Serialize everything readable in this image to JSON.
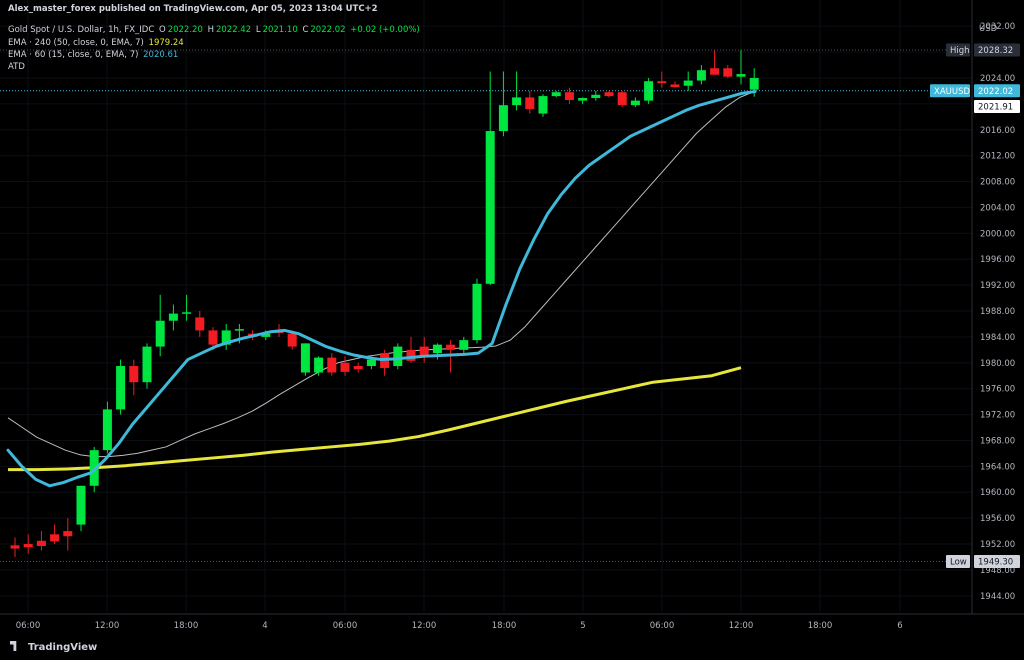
{
  "header": {
    "published": "Alex_master_forex published on TradingView.com, Apr 05, 2023 13:04 UTC+2",
    "symbol": "Gold Spot / U.S. Dollar, 1h, FX_IDC",
    "o_label": "O",
    "o": "2022.20",
    "h_label": "H",
    "h": "2022.42",
    "l_label": "L",
    "l": "2021.10",
    "c_label": "C",
    "c": "2022.02",
    "change": "+0.02 (+0.00%)",
    "ema240_label": "EMA · 240 (50, close, 0, EMA, 7)",
    "ema240_value": "1979.24",
    "ema60_label": "EMA · 60 (15, close, 0, EMA, 7)",
    "ema60_value": "2020.61",
    "atd_label": "ATD"
  },
  "footer": {
    "logo_text": "TradingView"
  },
  "colors": {
    "background": "#000000",
    "up": "#00e640",
    "down": "#f21c22",
    "ema_fast": "#3fb8da",
    "ema_slow": "#e7e63c",
    "ema_grey": "#bdbdbd",
    "axis_text": "#b2b5be",
    "price_tag": "#3fb8da"
  },
  "chart_data": {
    "type": "candlestick",
    "currency": "USD",
    "x_ticks": [
      "06:00",
      "12:00",
      "18:00",
      "4",
      "06:00",
      "12:00",
      "18:00",
      "5",
      "06:00",
      "12:00",
      "18:00",
      "6"
    ],
    "y_ticks": [
      "2032.00",
      "2028.00",
      "2024.00",
      "2020.00",
      "2016.00",
      "2012.00",
      "2008.00",
      "2004.00",
      "2000.00",
      "1996.00",
      "1992.00",
      "1988.00",
      "1984.00",
      "1980.00",
      "1976.00",
      "1972.00",
      "1968.00",
      "1964.00",
      "1960.00",
      "1956.00",
      "1952.00",
      "1948.00",
      "1944.00"
    ],
    "ylim": [
      1941.5,
      2034.5
    ],
    "high_label": "High",
    "high": "2028.32",
    "low_label": "Low",
    "low": "1949.30",
    "last_symbol": "XAUUSD",
    "last_price": "2022.02",
    "ema_tag": "2021.91",
    "candles": [
      {
        "o": 1951.8,
        "h": 1953,
        "l": 1950,
        "c": 1951.3
      },
      {
        "o": 1952.0,
        "h": 1953.5,
        "l": 1950.5,
        "c": 1951.5
      },
      {
        "o": 1952.5,
        "h": 1954,
        "l": 1951,
        "c": 1951.7
      },
      {
        "o": 1953.5,
        "h": 1955,
        "l": 1952,
        "c": 1952.4
      },
      {
        "o": 1954.0,
        "h": 1956,
        "l": 1951,
        "c": 1953.2
      },
      {
        "o": 1955.0,
        "h": 1961,
        "l": 1954,
        "c": 1961.0
      },
      {
        "o": 1961.0,
        "h": 1967,
        "l": 1960,
        "c": 1966.5
      },
      {
        "o": 1966.5,
        "h": 1974,
        "l": 1966,
        "c": 1972.8
      },
      {
        "o": 1972.8,
        "h": 1980.5,
        "l": 1972,
        "c": 1979.5
      },
      {
        "o": 1979.5,
        "h": 1980.5,
        "l": 1975,
        "c": 1977.0
      },
      {
        "o": 1977.0,
        "h": 1983,
        "l": 1976,
        "c": 1982.5
      },
      {
        "o": 1982.5,
        "h": 1990.5,
        "l": 1981,
        "c": 1986.5
      },
      {
        "o": 1986.5,
        "h": 1989,
        "l": 1985,
        "c": 1987.6
      },
      {
        "o": 1987.6,
        "h": 1990.5,
        "l": 1986.5,
        "c": 1987.8
      },
      {
        "o": 1987.0,
        "h": 1988,
        "l": 1984,
        "c": 1985.0
      },
      {
        "o": 1985.0,
        "h": 1985.5,
        "l": 1982,
        "c": 1982.8
      },
      {
        "o": 1982.8,
        "h": 1986,
        "l": 1982,
        "c": 1985.0
      },
      {
        "o": 1985.0,
        "h": 1986,
        "l": 1983,
        "c": 1985.2
      },
      {
        "o": 1984.5,
        "h": 1985,
        "l": 1983.5,
        "c": 1984.0
      },
      {
        "o": 1984.0,
        "h": 1985,
        "l": 1983.5,
        "c": 1984.5
      },
      {
        "o": 1985.0,
        "h": 1986,
        "l": 1984,
        "c": 1984.6
      },
      {
        "o": 1984.5,
        "h": 1985,
        "l": 1982,
        "c": 1982.5
      },
      {
        "o": 1978.5,
        "h": 1983,
        "l": 1978,
        "c": 1983.0
      },
      {
        "o": 1978.5,
        "h": 1981,
        "l": 1978,
        "c": 1980.8
      },
      {
        "o": 1980.8,
        "h": 1981.5,
        "l": 1978,
        "c": 1978.5
      },
      {
        "o": 1980.0,
        "h": 1981,
        "l": 1978,
        "c": 1978.6
      },
      {
        "o": 1979.5,
        "h": 1980,
        "l": 1978.5,
        "c": 1979.0
      },
      {
        "o": 1979.5,
        "h": 1981,
        "l": 1979,
        "c": 1980.5
      },
      {
        "o": 1981.5,
        "h": 1982,
        "l": 1978,
        "c": 1979.2
      },
      {
        "o": 1979.5,
        "h": 1983,
        "l": 1979,
        "c": 1982.5
      },
      {
        "o": 1982.0,
        "h": 1984,
        "l": 1980,
        "c": 1980.3
      },
      {
        "o": 1982.5,
        "h": 1984,
        "l": 1980,
        "c": 1981.0
      },
      {
        "o": 1981.5,
        "h": 1983,
        "l": 1980.5,
        "c": 1982.8
      },
      {
        "o": 1982.8,
        "h": 1983.5,
        "l": 1978.5,
        "c": 1982.0
      },
      {
        "o": 1982.0,
        "h": 1984,
        "l": 1981.5,
        "c": 1983.5
      },
      {
        "o": 1983.5,
        "h": 1993,
        "l": 1983,
        "c": 1992.2
      },
      {
        "o": 1992.2,
        "h": 2025,
        "l": 1992,
        "c": 2015.8
      },
      {
        "o": 2015.8,
        "h": 2025,
        "l": 2015,
        "c": 2019.8
      },
      {
        "o": 2019.8,
        "h": 2025,
        "l": 2019,
        "c": 2021.0
      },
      {
        "o": 2021.0,
        "h": 2022,
        "l": 2018.5,
        "c": 2019.2
      },
      {
        "o": 2018.5,
        "h": 2021.5,
        "l": 2018,
        "c": 2021.2
      },
      {
        "o": 2021.2,
        "h": 2022,
        "l": 2021,
        "c": 2021.8
      },
      {
        "o": 2021.8,
        "h": 2022.5,
        "l": 2020,
        "c": 2020.6
      },
      {
        "o": 2020.5,
        "h": 2021,
        "l": 2020,
        "c": 2020.9
      },
      {
        "o": 2020.9,
        "h": 2022,
        "l": 2020.5,
        "c": 2021.4
      },
      {
        "o": 2021.8,
        "h": 2022,
        "l": 2021,
        "c": 2021.2
      },
      {
        "o": 2021.8,
        "h": 2022,
        "l": 2019.5,
        "c": 2019.8
      },
      {
        "o": 2019.8,
        "h": 2021,
        "l": 2019.5,
        "c": 2020.5
      },
      {
        "o": 2020.5,
        "h": 2024,
        "l": 2020,
        "c": 2023.5
      },
      {
        "o": 2023.5,
        "h": 2025,
        "l": 2022.5,
        "c": 2023.2
      },
      {
        "o": 2023.0,
        "h": 2023.5,
        "l": 2022.5,
        "c": 2022.6
      },
      {
        "o": 2022.8,
        "h": 2025,
        "l": 2022,
        "c": 2023.6
      },
      {
        "o": 2023.6,
        "h": 2026,
        "l": 2023,
        "c": 2025.2
      },
      {
        "o": 2025.5,
        "h": 2028.3,
        "l": 2024.5,
        "c": 2024.5
      },
      {
        "o": 2025.5,
        "h": 2026,
        "l": 2024,
        "c": 2024.2
      },
      {
        "o": 2024.2,
        "h": 2028.3,
        "l": 2023,
        "c": 2024.6
      },
      {
        "o": 2022.2,
        "h": 2025.5,
        "l": 2021.1,
        "c": 2024.0
      }
    ],
    "ema_fast": [
      1966.5,
      1964.0,
      1962.0,
      1961.0,
      1961.5,
      1962.3,
      1963.0,
      1965.0,
      1967.5,
      1970.5,
      1973.0,
      1975.5,
      1978.0,
      1980.5,
      1981.5,
      1982.5,
      1983.2,
      1983.8,
      1984.3,
      1984.8,
      1985.0,
      1984.5,
      1983.5,
      1982.5,
      1981.8,
      1981.2,
      1980.8,
      1980.5,
      1980.6,
      1980.8,
      1981.0,
      1981.1,
      1981.2,
      1981.3,
      1981.5,
      1983.0,
      1989.0,
      1994.5,
      1999.0,
      2003.0,
      2006.0,
      2008.5,
      2010.5,
      2012.0,
      2013.5,
      2015.0,
      2016.0,
      2017.0,
      2018.0,
      2019.0,
      2019.8,
      2020.4,
      2021.0,
      2021.6,
      2021.9
    ],
    "ema_grey": [
      1971.5,
      1970.0,
      1968.5,
      1967.5,
      1966.5,
      1965.8,
      1965.5,
      1965.5,
      1965.7,
      1966.0,
      1966.5,
      1967.0,
      1968.0,
      1969.0,
      1969.8,
      1970.6,
      1971.5,
      1972.5,
      1973.8,
      1975.2,
      1976.5,
      1977.8,
      1979.0,
      1980.0,
      1980.5,
      1981.0,
      1981.3,
      1981.6,
      1981.8,
      1982.0,
      1982.1,
      1982.2,
      1982.3,
      1982.4,
      1982.6,
      1983.5,
      1985.5,
      1988.0,
      1990.5,
      1993.0,
      1995.5,
      1998.0,
      2000.5,
      2003.0,
      2005.5,
      2008.0,
      2010.5,
      2013.0,
      2015.5,
      2017.5,
      2019.5,
      2021.0,
      2021.9
    ],
    "ema_slow": [
      1963.5,
      1963.5,
      1963.6,
      1963.8,
      1964.1,
      1964.5,
      1964.9,
      1965.3,
      1965.7,
      1966.2,
      1966.6,
      1967.0,
      1967.4,
      1967.9,
      1968.6,
      1969.6,
      1970.7,
      1971.8,
      1972.9,
      1974.0,
      1975.0,
      1976.0,
      1977.0,
      1977.5,
      1978.0,
      1979.24
    ]
  }
}
